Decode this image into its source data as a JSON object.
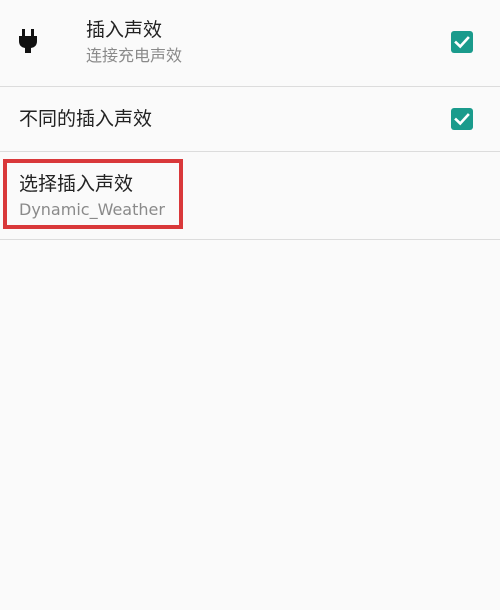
{
  "preferences": {
    "plug_sound": {
      "title": "插入声效",
      "summary": "连接充电声效",
      "icon": "plug-icon",
      "checked": true
    },
    "different_plug_sound": {
      "title": "不同的插入声效",
      "checked": true
    },
    "select_plug_sound": {
      "title": "选择插入声效",
      "summary": "Dynamic_Weather"
    }
  },
  "colors": {
    "accent": "#1a9b8c",
    "highlight": "#d9383a",
    "background": "#fafafa",
    "divider": "#dcdcdc"
  }
}
